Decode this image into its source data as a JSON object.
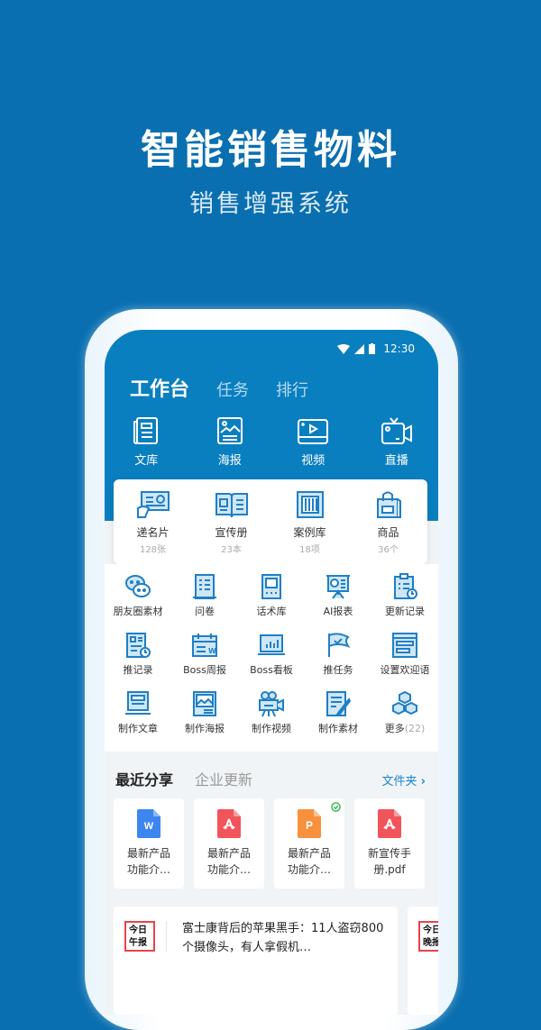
{
  "hero": {
    "title": "智能销售物料",
    "subtitle": "销售增强系统"
  },
  "status_bar": {
    "time": "12:30",
    "icons": [
      "wifi-icon",
      "signal-icon",
      "battery-icon"
    ]
  },
  "tabs": [
    {
      "label": "工作台",
      "active": true
    },
    {
      "label": "任务",
      "active": false
    },
    {
      "label": "排行",
      "active": false
    }
  ],
  "top_icons": [
    {
      "label": "文库",
      "icon": "library-icon"
    },
    {
      "label": "海报",
      "icon": "poster-icon"
    },
    {
      "label": "视频",
      "icon": "video-icon"
    },
    {
      "label": "直播",
      "icon": "live-icon"
    }
  ],
  "features": [
    {
      "label": "递名片",
      "count": "128张",
      "icon": "business-card-icon"
    },
    {
      "label": "宣传册",
      "count": "23本",
      "icon": "brochure-icon"
    },
    {
      "label": "案例库",
      "count": "18项",
      "icon": "case-library-icon"
    },
    {
      "label": "商品",
      "count": "36个",
      "icon": "shopping-bag-icon"
    }
  ],
  "tools": [
    [
      {
        "label": "朋友圈素材",
        "icon": "wechat-icon"
      },
      {
        "label": "问卷",
        "icon": "survey-icon"
      },
      {
        "label": "话术库",
        "icon": "script-library-icon"
      },
      {
        "label": "AI报表",
        "icon": "report-icon"
      },
      {
        "label": "更新记录",
        "icon": "clipboard-icon"
      }
    ],
    [
      {
        "label": "推记录",
        "icon": "push-record-icon"
      },
      {
        "label": "Boss周报",
        "icon": "calendar-icon"
      },
      {
        "label": "Boss看板",
        "icon": "dashboard-icon"
      },
      {
        "label": "推任务",
        "icon": "flag-icon"
      },
      {
        "label": "设置欢迎语",
        "icon": "welcome-icon"
      }
    ],
    [
      {
        "label": "制作文章",
        "icon": "computer-icon"
      },
      {
        "label": "制作海报",
        "icon": "image-icon"
      },
      {
        "label": "制作视频",
        "icon": "camera-icon"
      },
      {
        "label": "制作素材",
        "icon": "edit-icon"
      },
      {
        "label": "更多",
        "extra": "(22)",
        "icon": "cubes-icon"
      }
    ]
  ],
  "recent": {
    "tabs": [
      {
        "label": "最近分享",
        "active": true
      },
      {
        "label": "企业更新",
        "active": false
      }
    ],
    "folder_link": "文件夹",
    "files": [
      {
        "name_line1": "最新产品",
        "name_line2": "功能介…",
        "type": "W",
        "color": "#3d86f0",
        "checked": false
      },
      {
        "name_line1": "最新产品",
        "name_line2": "功能介…",
        "type": "pdf",
        "color": "#f2545b",
        "checked": false
      },
      {
        "name_line1": "最新产品",
        "name_line2": "功能介…",
        "type": "P",
        "color": "#f7913d",
        "checked": true
      },
      {
        "name_line1": "新宣传手",
        "name_line2": "册.pdf",
        "type": "pdf",
        "color": "#f2545b",
        "checked": false
      }
    ],
    "news": [
      {
        "logo_line1": "今日",
        "logo_line2": "午报",
        "title": "富士康背后的苹果黑手：11人盗窃800个摄像头，有人拿假机…"
      },
      {
        "logo_line1": "今日",
        "logo_line2": "晚报"
      }
    ]
  },
  "colors": {
    "brand_blue": "#0a7fc0",
    "background_blue": "#0a6fb0",
    "link_blue": "#1a86d0",
    "icon_blue": "#1f7fc6"
  }
}
